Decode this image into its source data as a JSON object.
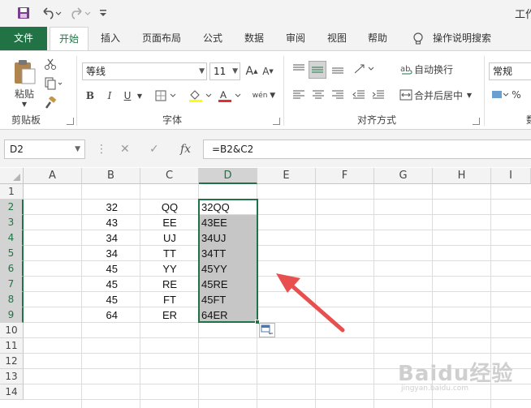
{
  "quick_access": {
    "save_icon": "save-icon",
    "undo_icon": "undo-icon",
    "redo_icon": "redo-icon",
    "customize_icon": "customize-icon",
    "window_title": "工作"
  },
  "tabs": [
    {
      "label": "文件"
    },
    {
      "label": "开始"
    },
    {
      "label": "插入"
    },
    {
      "label": "页面布局"
    },
    {
      "label": "公式"
    },
    {
      "label": "数据"
    },
    {
      "label": "审阅"
    },
    {
      "label": "视图"
    },
    {
      "label": "帮助"
    },
    {
      "label": "操作说明搜索"
    }
  ],
  "ribbon": {
    "clipboard": {
      "paste_label": "粘贴",
      "group_label": "剪贴板"
    },
    "font": {
      "font_name": "等线",
      "font_size": "11",
      "bold": "B",
      "italic": "I",
      "underline": "U",
      "font_color_glyph": "A",
      "wen_glyph": "wén",
      "group_label": "字体"
    },
    "alignment": {
      "wrap_text": "自动换行",
      "merge_center": "合并后居中",
      "group_label": "对齐方式"
    },
    "number": {
      "format": "常规",
      "group_label": "数"
    }
  },
  "formula_bar": {
    "name_box": "D2",
    "cancel": "✕",
    "enter": "✓",
    "fx": "fx",
    "formula": "=B2&C2"
  },
  "columns": [
    "A",
    "B",
    "C",
    "D",
    "E",
    "F",
    "G",
    "H",
    "I"
  ],
  "rows": [
    "1",
    "2",
    "3",
    "4",
    "5",
    "6",
    "7",
    "8",
    "9",
    "10",
    "11",
    "12",
    "13",
    "14"
  ],
  "sheet": {
    "B": [
      "",
      "32",
      "43",
      "34",
      "34",
      "45",
      "45",
      "45",
      "64"
    ],
    "C": [
      "",
      "QQ",
      "EE",
      "UJ",
      "TT",
      "YY",
      "RE",
      "FT",
      "ER"
    ],
    "D": [
      "",
      "32QQ",
      "43EE",
      "34UJ",
      "34TT",
      "45YY",
      "45RE",
      "45FT",
      "64ER"
    ]
  },
  "colors": {
    "accent": "#217346",
    "selection_fill": "#c6c6c6",
    "arrow": "#e8504f"
  },
  "watermark": {
    "text": "Baidu经验",
    "sub": "jingyan.baidu.com"
  }
}
